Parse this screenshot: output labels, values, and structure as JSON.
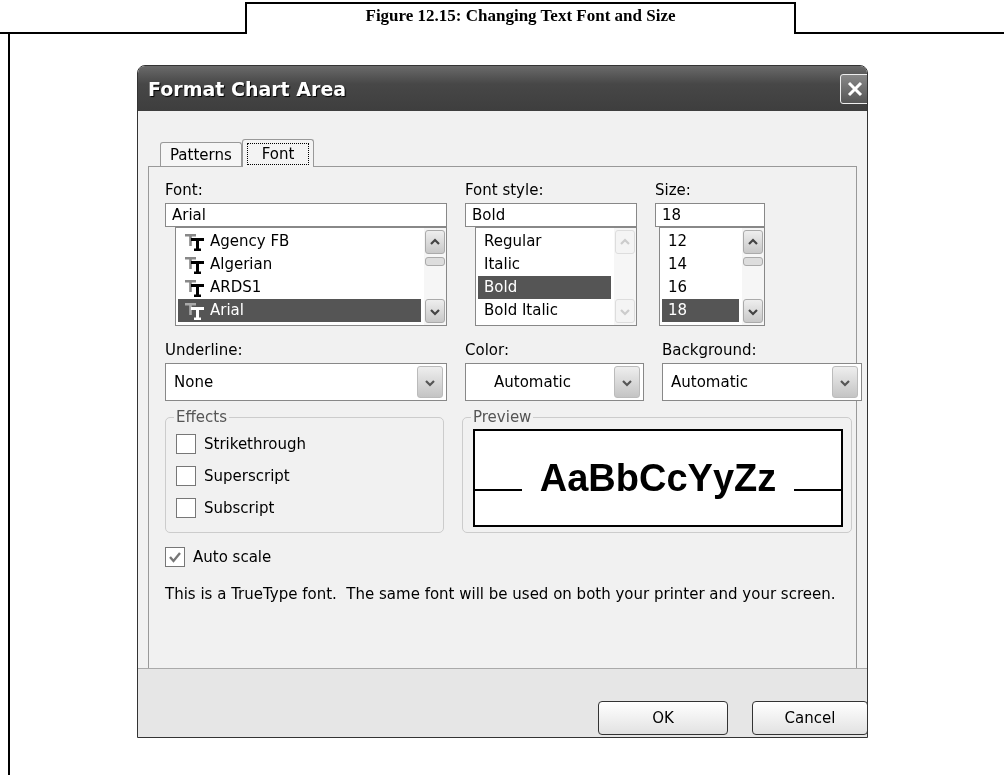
{
  "caption": "Figure 12.15: Changing Text Font and Size",
  "window": {
    "title": "Format Chart Area"
  },
  "tabs": [
    {
      "label": "Patterns",
      "selected": false
    },
    {
      "label": "Font",
      "selected": true
    }
  ],
  "font_columns": [
    {
      "label": "Font:",
      "value": "Arial",
      "scrollbar_disabled": false,
      "items": [
        {
          "label": "Agency FB",
          "kind": "truetype",
          "selected": false
        },
        {
          "label": "Algerian",
          "kind": "truetype",
          "selected": false
        },
        {
          "label": "ARDS1",
          "kind": "truetype",
          "selected": false
        },
        {
          "label": "Arial",
          "kind": "truetype",
          "selected": true
        }
      ]
    },
    {
      "label": "Font style:",
      "value": "Bold",
      "scrollbar_disabled": true,
      "items": [
        {
          "label": "Regular",
          "kind": "plain",
          "selected": false
        },
        {
          "label": "Italic",
          "kind": "plain",
          "selected": false
        },
        {
          "label": "Bold",
          "kind": "plain",
          "selected": true
        },
        {
          "label": "Bold Italic",
          "kind": "plain",
          "selected": false
        }
      ]
    },
    {
      "label": "Size:",
      "value": "18",
      "scrollbar_disabled": false,
      "items": [
        {
          "label": "12",
          "kind": "plain",
          "selected": false
        },
        {
          "label": "14",
          "kind": "plain",
          "selected": false
        },
        {
          "label": "16",
          "kind": "plain",
          "selected": false
        },
        {
          "label": "18",
          "kind": "plain",
          "selected": true
        }
      ]
    }
  ],
  "dropdowns": [
    {
      "label": "Underline:",
      "value": "None",
      "kind": "plain"
    },
    {
      "label": "Color:",
      "value": "Automatic",
      "kind": "color"
    },
    {
      "label": "Background:",
      "value": "Automatic",
      "kind": "plain"
    }
  ],
  "effects": {
    "title": "Effects",
    "options": [
      {
        "label": "Strikethrough",
        "checked": false
      },
      {
        "label": "Superscript",
        "checked": false
      },
      {
        "label": "Subscript",
        "checked": false
      }
    ]
  },
  "preview": {
    "title": "Preview",
    "sample": "AaBbCcYyZz"
  },
  "auto_scale": {
    "label": "Auto scale",
    "checked": true
  },
  "info": "This is a TrueType font.  The same font will be used on both your printer and your screen.",
  "buttons": [
    {
      "label": "OK"
    },
    {
      "label": "Cancel"
    }
  ]
}
